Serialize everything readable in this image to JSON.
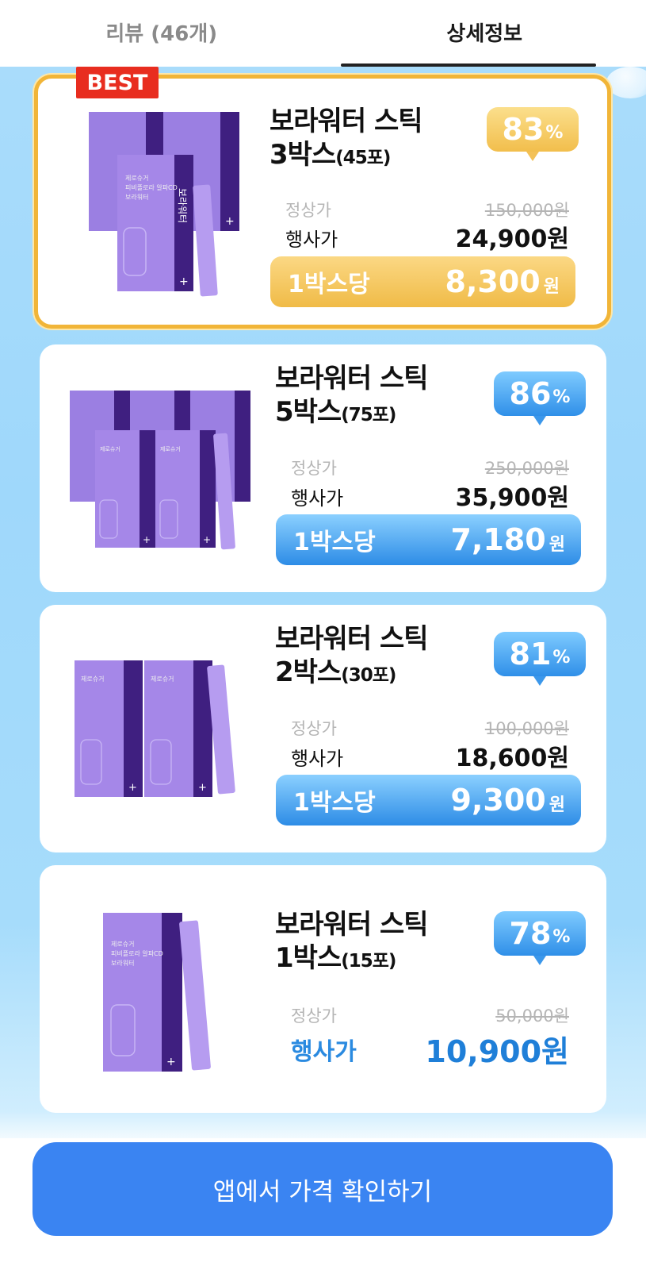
{
  "tabs": [
    {
      "label": "리뷰 (46개)",
      "active": false
    },
    {
      "label": "상세정보",
      "active": true
    }
  ],
  "badge": "BEST",
  "cards": [
    {
      "title_line1": "보라워터 스틱",
      "title_line2": "3박스",
      "title_count": "(45포)",
      "discount_number": "83",
      "discount_unit": "%",
      "regular_label": "정상가",
      "regular_price": "150,000원",
      "sale_label": "행사가",
      "sale_price": "24,900원",
      "per_label": "1박스당",
      "per_price": "8,300",
      "per_unit": "원",
      "theme": "gold"
    },
    {
      "title_line1": "보라워터 스틱",
      "title_line2": "5박스",
      "title_count": "(75포)",
      "discount_number": "86",
      "discount_unit": "%",
      "regular_label": "정상가",
      "regular_price": "250,000원",
      "sale_label": "행사가",
      "sale_price": "35,900원",
      "per_label": "1박스당",
      "per_price": "7,180",
      "per_unit": "원",
      "theme": "blue"
    },
    {
      "title_line1": "보라워터 스틱",
      "title_line2": "2박스",
      "title_count": "(30포)",
      "discount_number": "81",
      "discount_unit": "%",
      "regular_label": "정상가",
      "regular_price": "100,000원",
      "sale_label": "행사가",
      "sale_price": "18,600원",
      "per_label": "1박스당",
      "per_price": "9,300",
      "per_unit": "원",
      "theme": "blue"
    },
    {
      "title_line1": "보라워터 스틱",
      "title_line2": "1박스",
      "title_count": "(15포)",
      "discount_number": "78",
      "discount_unit": "%",
      "regular_label": "정상가",
      "regular_price": "50,000원",
      "sale_label": "행사가",
      "sale_price": "10,900원",
      "theme": "blue"
    }
  ],
  "cta": {
    "label": "앱에서 가격 확인하기"
  },
  "colors": {
    "best_border": "#f1b538",
    "best_badge": "#e82d1f",
    "accent_blue": "#3a84f2",
    "product_purple": "#9a7ce0",
    "product_dark": "#3d1d7a"
  }
}
